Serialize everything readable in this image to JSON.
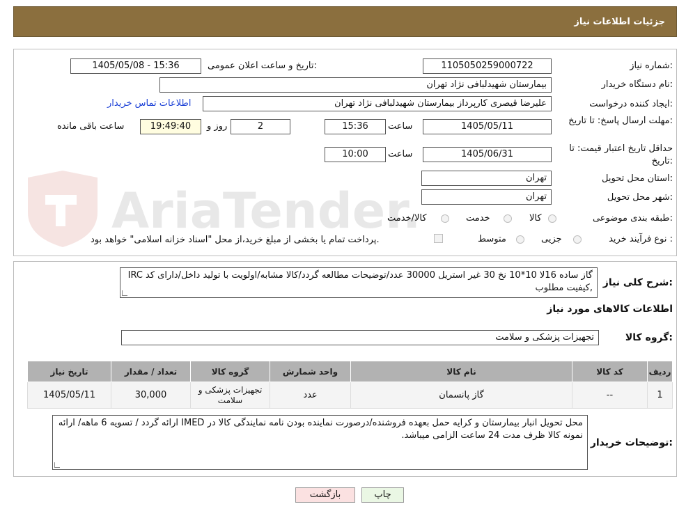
{
  "header": {
    "title": "جزئیات اطلاعات نیاز"
  },
  "watermark": {
    "text": "AriaTender.neT"
  },
  "form": {
    "need_number_label": "شماره نیاز:",
    "need_number": "1105050259000722",
    "announce_label": "تاریخ و ساعت اعلان عمومی:",
    "announce_value": "1405/05/08 - 15:36",
    "buyer_org_label": "نام دستگاه خریدار:",
    "buyer_org": "بیمارستان شهیدلبافی نژاد تهران",
    "creator_label": "ایجاد کننده درخواست:",
    "creator": "علیرضا قیصری کارپرداز بیمارستان شهیدلبافی نژاد تهران",
    "contact_link": "اطلاعات تماس خریدار",
    "deadline_label": "مهلت ارسال پاسخ: تا تاریخ:",
    "deadline_date": "1405/05/11",
    "time_label": "ساعت",
    "deadline_time": "15:36",
    "days_value": "2",
    "days_label": "روز و",
    "remaining_time": "19:49:40",
    "remaining_label": "ساعت باقی مانده",
    "validity_label": "حداقل تاریخ اعتبار قیمت: تا تاریخ:",
    "validity_date": "1405/06/31",
    "validity_time": "10:00",
    "province_label": "استان محل تحویل:",
    "province": "تهران",
    "city_label": "شهر محل تحویل:",
    "city": "تهران",
    "category_label": "طبقه بندی موضوعی:",
    "category_options": [
      "کالا",
      "خدمت",
      "کالا/خدمت"
    ],
    "process_label": "نوع فرآیند خرید :",
    "process_options": [
      "جزیی",
      "متوسط"
    ],
    "payment_note": "پرداخت تمام یا بخشی از مبلغ خرید،از محل \"اسناد خزانه اسلامی\" خواهد بود."
  },
  "details": {
    "summary_label": "شرح کلی نیاز:",
    "summary": "گاز ساده 16لا  10*10 نخ 30 غیر استریل  30000 عدد/توضیحات مطالعه گردد/کالا مشابه/اولویت با تولید داخل/دارای کد IRC ,کیفیت مطلوب",
    "goods_info_title": "اطلاعات کالاهای مورد نیاز",
    "goods_group_label": "گروه کالا:",
    "goods_group": "تجهیزات پزشکی و سلامت",
    "table": {
      "headers": [
        "ردیف",
        "کد کالا",
        "نام کالا",
        "واحد شمارش",
        "گروه کالا",
        "تعداد / مقدار",
        "تاریخ نیاز"
      ],
      "rows": [
        [
          "1",
          "--",
          "گاز پانسمان",
          "عدد",
          "تجهیزات پزشکی و سلامت",
          "30,000",
          "1405/05/11"
        ]
      ]
    },
    "buyer_notes_label": "توضیحات خریدار:",
    "buyer_notes": "محل تحویل انبار بیمارستان و کرایه حمل بعهده فروشنده/درصورت نماینده بودن نامه نمایندگی کالا در  IMED ارائه گردد / تسویه 6 ماهه/ ارائه نمونه کالا ظرف مدت 24 ساعت الزامی میباشد."
  },
  "buttons": {
    "print": "چاپ",
    "back": "بازگشت"
  }
}
